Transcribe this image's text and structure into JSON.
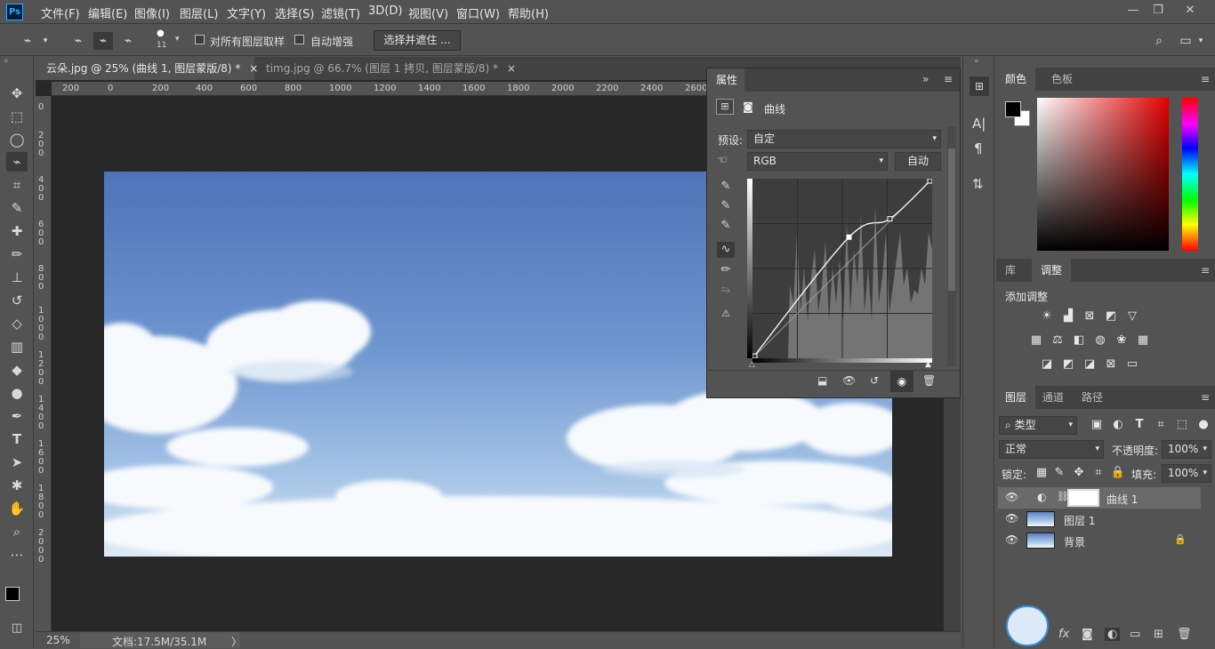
{
  "app": {
    "logo": "Ps"
  },
  "menu": [
    "文件(F)",
    "编辑(E)",
    "图像(I)",
    "图层(L)",
    "文字(Y)",
    "选择(S)",
    "滤镜(T)",
    "3D(D)",
    "视图(V)",
    "窗口(W)",
    "帮助(H)"
  ],
  "window_controls": {
    "minimize": "—",
    "restore": "❐",
    "close": "✕"
  },
  "options": {
    "brush_size": "11",
    "sample_all_layers": "对所有图层取样",
    "auto_enhance": "自动增强",
    "select_and_mask": "选择并遮住 ..."
  },
  "tabs": [
    {
      "label": "云朵.jpg @ 25% (曲线 1, 图层蒙版/8) *",
      "active": true
    },
    {
      "label": "timg.jpg @ 66.7% (图层 1 拷贝, 图层蒙版/8) *",
      "active": false
    }
  ],
  "ruler": {
    "top": [
      "200",
      "0",
      "200",
      "400",
      "600",
      "800",
      "1000",
      "1200",
      "1400",
      "1600",
      "1800",
      "2000",
      "2200",
      "2400",
      "2600"
    ],
    "left": [
      "0",
      "2 0 0",
      "4 0 0",
      "6 0 0",
      "8 0 0",
      "1 0 0 0",
      "1 2 0 0",
      "1 4 0 0",
      "1 6 0 0",
      "1 8 0 0",
      "2 0 0 0"
    ]
  },
  "status": {
    "zoom": "25%",
    "doc": "文档:17.5M/35.1M",
    "arrow": "〉"
  },
  "properties": {
    "tab": "属性",
    "title": "曲线",
    "preset_label": "预设:",
    "preset_value": "自定",
    "channel": "RGB",
    "auto_button": "自动"
  },
  "color_panel": {
    "tabs": [
      "颜色",
      "色板"
    ]
  },
  "adjust_panel": {
    "tabs": [
      "库",
      "调整"
    ],
    "heading": "添加调整"
  },
  "layers_panel": {
    "tabs": [
      "图层",
      "通道",
      "路径"
    ],
    "filter_kind": "类型",
    "blend_mode": "正常",
    "opacity_label": "不透明度:",
    "opacity_value": "100%",
    "lock_label": "锁定:",
    "fill_label": "填充:",
    "fill_value": "100%",
    "layers": [
      {
        "name": "曲线 1",
        "type": "adjustment",
        "selected": true
      },
      {
        "name": "图层 1",
        "type": "image",
        "selected": false
      },
      {
        "name": "背景",
        "type": "image",
        "locked": true,
        "selected": false
      }
    ],
    "bottom_icons": [
      "fx"
    ]
  },
  "curve": {
    "points": [
      [
        0,
        0
      ],
      [
        137,
        172
      ],
      [
        195,
        198
      ]
    ]
  },
  "colors": {
    "accent": "#31a8ff",
    "panel": "#535353",
    "dark": "#424242",
    "canvas": "#282828"
  }
}
